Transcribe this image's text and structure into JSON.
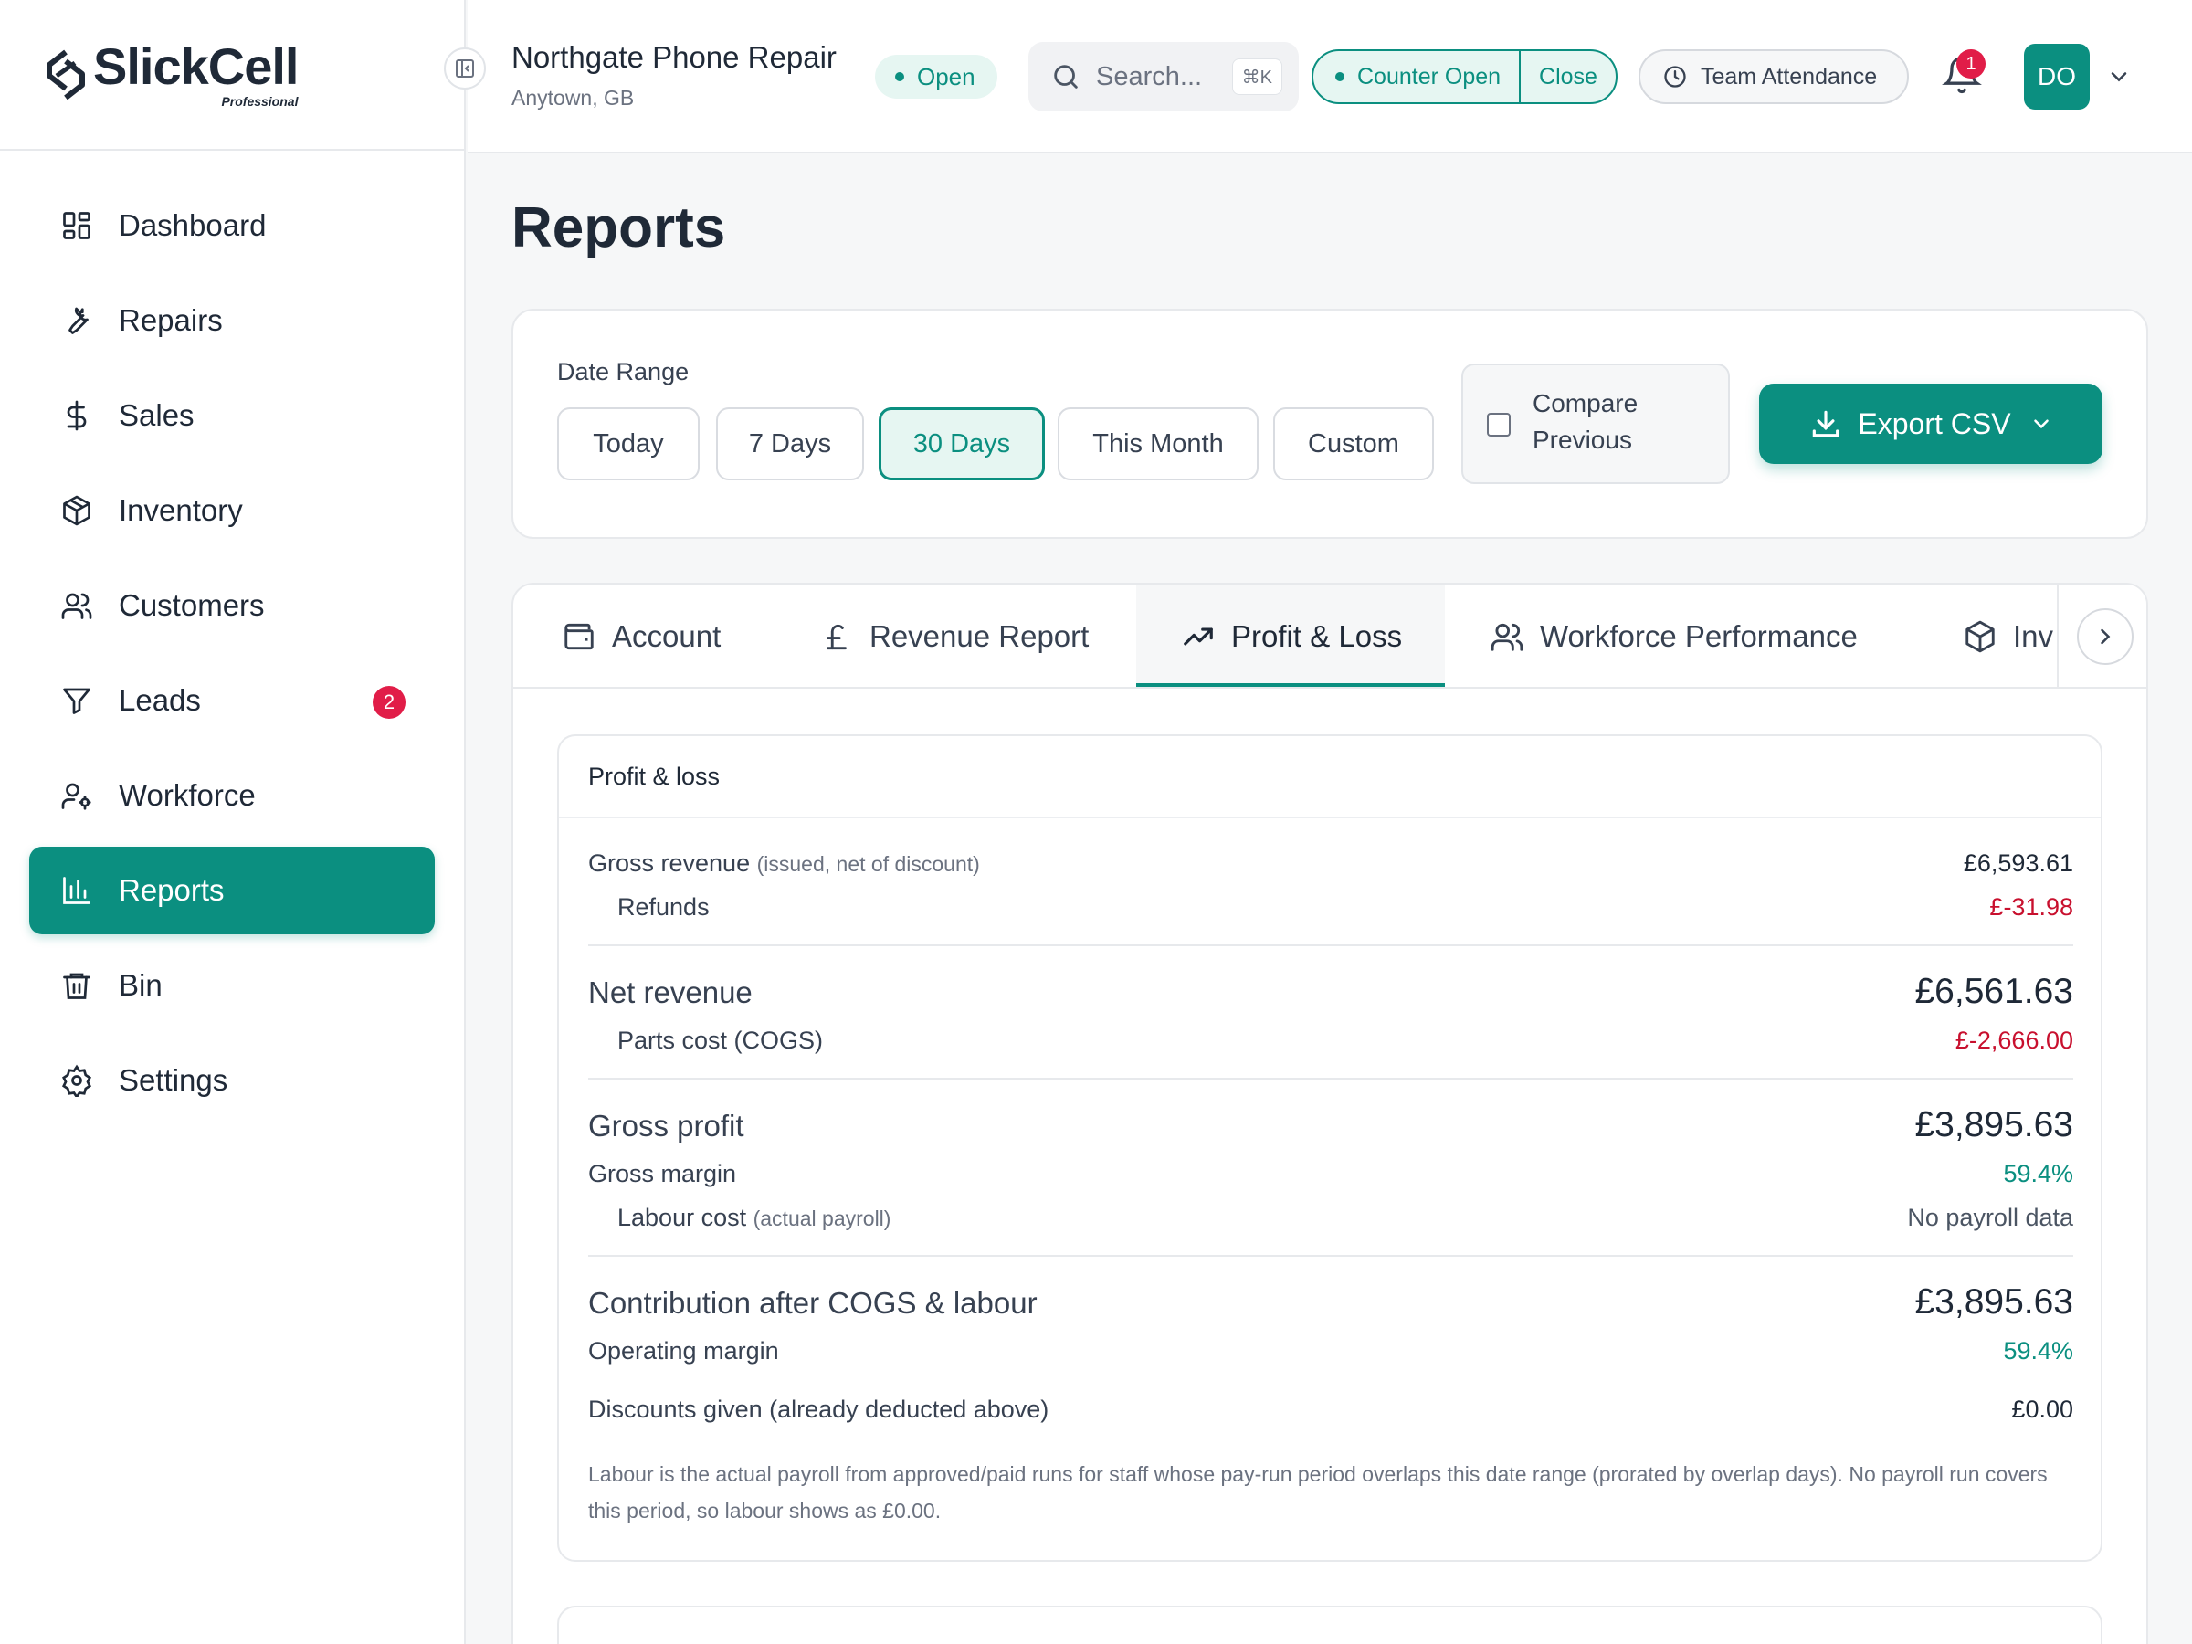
{
  "brand": {
    "name": "SlickCell",
    "tier": "Professional"
  },
  "sidebar": {
    "items": [
      {
        "label": "Dashboard",
        "icon": "dashboard-grid-icon"
      },
      {
        "label": "Repairs",
        "icon": "wrench-icon"
      },
      {
        "label": "Sales",
        "icon": "dollar-icon"
      },
      {
        "label": "Inventory",
        "icon": "box-icon"
      },
      {
        "label": "Customers",
        "icon": "users-icon"
      },
      {
        "label": "Leads",
        "icon": "funnel-icon",
        "badge": "2"
      },
      {
        "label": "Workforce",
        "icon": "user-gear-icon"
      },
      {
        "label": "Reports",
        "icon": "bar-chart-icon",
        "active": true
      },
      {
        "label": "Bin",
        "icon": "trash-icon"
      },
      {
        "label": "Settings",
        "icon": "gear-icon"
      }
    ]
  },
  "header": {
    "shop_name": "Northgate Phone Repair",
    "shop_location": "Anytown, GB",
    "status": "Open",
    "search_placeholder": "Search...",
    "search_shortcut": "⌘K",
    "counter_status": "Counter Open",
    "counter_action": "Close",
    "attendance_label": "Team Attendance",
    "notifications_count": "1",
    "user_initials": "DO"
  },
  "page": {
    "title": "Reports"
  },
  "filters": {
    "date_range_label": "Date Range",
    "ranges": [
      "Today",
      "7 Days",
      "30 Days",
      "This Month",
      "Custom"
    ],
    "selected_range": "30 Days",
    "compare_label": "Compare Previous",
    "compare_checked": false,
    "export_label": "Export CSV"
  },
  "tabs": [
    {
      "label": "Account",
      "icon": "wallet-icon"
    },
    {
      "label": "Revenue Report",
      "icon": "pound-icon"
    },
    {
      "label": "Profit & Loss",
      "icon": "trending-up-icon",
      "active": true
    },
    {
      "label": "Workforce Performance",
      "icon": "users-icon"
    },
    {
      "label": "Inv",
      "icon": "box-icon"
    }
  ],
  "pnl": {
    "title": "Profit & loss",
    "gross_revenue_label": "Gross revenue",
    "gross_revenue_note": "(issued, net of discount)",
    "gross_revenue_value": "£6,593.61",
    "refunds_label": "Refunds",
    "refunds_value": "£-31.98",
    "net_revenue_label": "Net revenue",
    "net_revenue_value": "£6,561.63",
    "parts_cost_label": "Parts cost (COGS)",
    "parts_cost_value": "£-2,666.00",
    "gross_profit_label": "Gross profit",
    "gross_profit_value": "£3,895.63",
    "gross_margin_label": "Gross margin",
    "gross_margin_value": "59.4%",
    "labour_cost_label": "Labour cost",
    "labour_cost_note": "(actual payroll)",
    "labour_cost_value": "No payroll data",
    "contribution_label": "Contribution after COGS & labour",
    "contribution_value": "£3,895.63",
    "operating_margin_label": "Operating margin",
    "operating_margin_value": "59.4%",
    "discounts_label": "Discounts given (already deducted above)",
    "discounts_value": "£0.00",
    "footnote": "Labour is the actual payroll from approved/paid runs for staff whose pay-run period overlaps this date range (prorated by overlap days). No payroll run covers this period, so labour shows as £0.00."
  }
}
